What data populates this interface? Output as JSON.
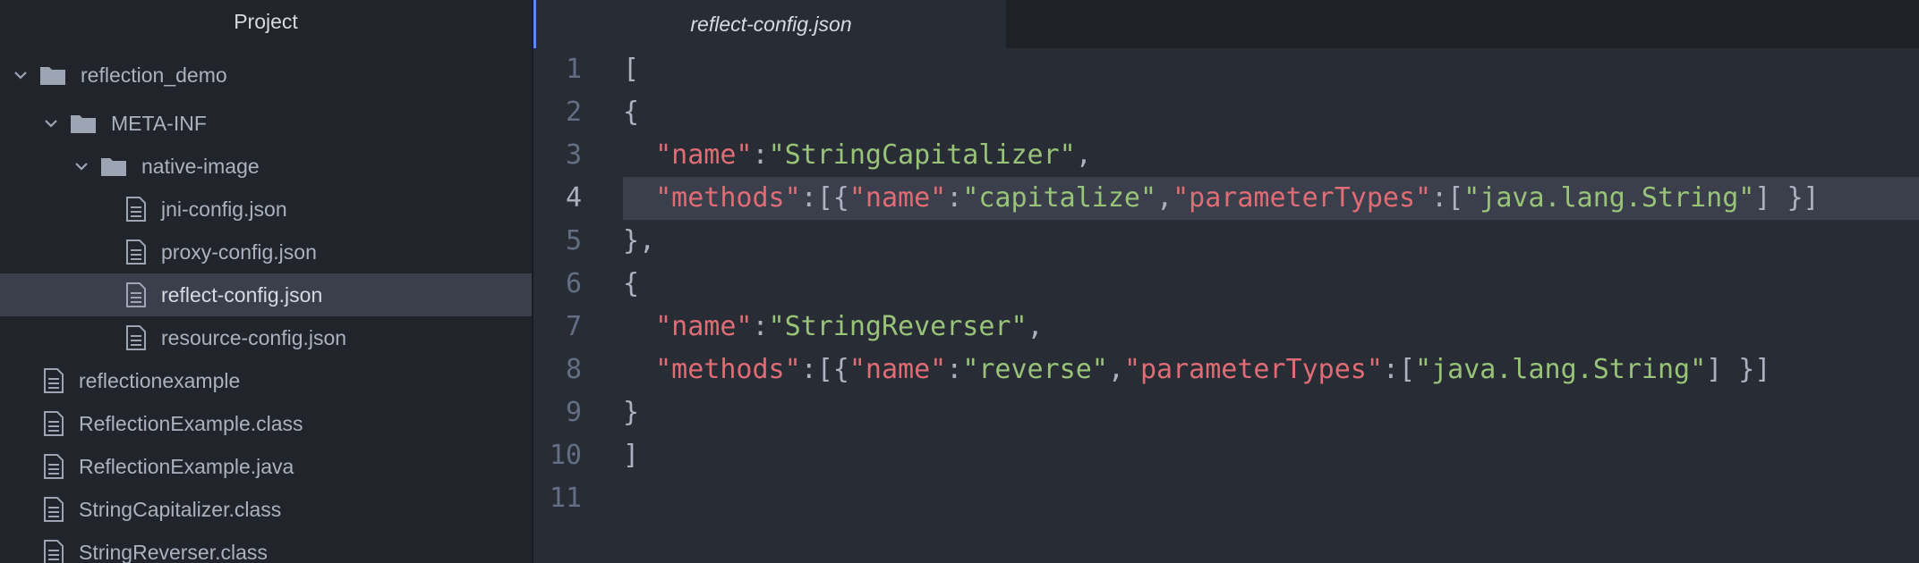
{
  "sidebar": {
    "title": "Project",
    "items": [
      {
        "label": "reflection_demo",
        "type": "folder",
        "depth": 0,
        "expanded": true
      },
      {
        "label": "META-INF",
        "type": "folder",
        "depth": 1,
        "expanded": true
      },
      {
        "label": "native-image",
        "type": "folder",
        "depth": 2,
        "expanded": true
      },
      {
        "label": "jni-config.json",
        "type": "file",
        "depth": 3
      },
      {
        "label": "proxy-config.json",
        "type": "file",
        "depth": 3
      },
      {
        "label": "reflect-config.json",
        "type": "file",
        "depth": 3,
        "selected": true
      },
      {
        "label": "resource-config.json",
        "type": "file",
        "depth": 3
      },
      {
        "label": "reflectionexample",
        "type": "file",
        "depth": 1
      },
      {
        "label": "ReflectionExample.class",
        "type": "file",
        "depth": 1
      },
      {
        "label": "ReflectionExample.java",
        "type": "file",
        "depth": 1
      },
      {
        "label": "StringCapitalizer.class",
        "type": "file",
        "depth": 1
      },
      {
        "label": "StringReverser.class",
        "type": "file",
        "depth": 1
      }
    ]
  },
  "editor": {
    "active_tab": "reflect-config.json",
    "current_line": 4,
    "lines": [
      {
        "num": "1",
        "tokens": [
          {
            "t": "p",
            "v": "["
          }
        ]
      },
      {
        "num": "2",
        "tokens": [
          {
            "t": "p",
            "v": "{"
          }
        ]
      },
      {
        "num": "3",
        "tokens": [
          {
            "t": "p",
            "v": "  "
          },
          {
            "t": "key",
            "v": "\"name\""
          },
          {
            "t": "p",
            "v": ":"
          },
          {
            "t": "str",
            "v": "\"StringCapitalizer\""
          },
          {
            "t": "p",
            "v": ","
          }
        ]
      },
      {
        "num": "4",
        "tokens": [
          {
            "t": "p",
            "v": "  "
          },
          {
            "t": "key",
            "v": "\"methods\""
          },
          {
            "t": "p",
            "v": ":[{"
          },
          {
            "t": "key",
            "v": "\"name\""
          },
          {
            "t": "p",
            "v": ":"
          },
          {
            "t": "str",
            "v": "\"capitalize\""
          },
          {
            "t": "p",
            "v": ","
          },
          {
            "t": "key",
            "v": "\"parameterTypes\""
          },
          {
            "t": "p",
            "v": ":["
          },
          {
            "t": "str",
            "v": "\"java.lang.String\""
          },
          {
            "t": "p",
            "v": "] }]"
          }
        ]
      },
      {
        "num": "5",
        "tokens": [
          {
            "t": "p",
            "v": "},"
          }
        ]
      },
      {
        "num": "6",
        "tokens": [
          {
            "t": "p",
            "v": "{"
          }
        ]
      },
      {
        "num": "7",
        "tokens": [
          {
            "t": "p",
            "v": "  "
          },
          {
            "t": "key",
            "v": "\"name\""
          },
          {
            "t": "p",
            "v": ":"
          },
          {
            "t": "str",
            "v": "\"StringReverser\""
          },
          {
            "t": "p",
            "v": ","
          }
        ]
      },
      {
        "num": "8",
        "tokens": [
          {
            "t": "p",
            "v": "  "
          },
          {
            "t": "key",
            "v": "\"methods\""
          },
          {
            "t": "p",
            "v": ":[{"
          },
          {
            "t": "key",
            "v": "\"name\""
          },
          {
            "t": "p",
            "v": ":"
          },
          {
            "t": "str",
            "v": "\"reverse\""
          },
          {
            "t": "p",
            "v": ","
          },
          {
            "t": "key",
            "v": "\"parameterTypes\""
          },
          {
            "t": "p",
            "v": ":["
          },
          {
            "t": "str",
            "v": "\"java.lang.String\""
          },
          {
            "t": "p",
            "v": "] }]"
          }
        ]
      },
      {
        "num": "9",
        "tokens": [
          {
            "t": "p",
            "v": "}"
          }
        ]
      },
      {
        "num": "10",
        "tokens": [
          {
            "t": "p",
            "v": "]"
          }
        ]
      },
      {
        "num": "11",
        "tokens": []
      }
    ]
  },
  "colors": {
    "key": "#e06c75",
    "string": "#98c379",
    "punctuation": "#abb2bf",
    "accent": "#568af2"
  }
}
